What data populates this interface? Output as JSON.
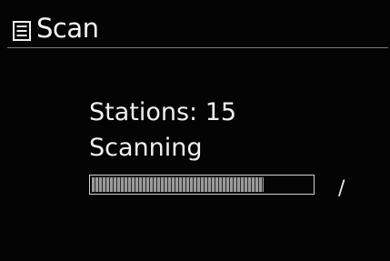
{
  "header": {
    "icon": "list-menu-icon",
    "title": "Scan"
  },
  "scan": {
    "stations_text": "Stations: 15",
    "status_text": "Scanning",
    "progress_fraction": 0.78,
    "spinner_glyph": "/"
  },
  "colors": {
    "background": "#040404",
    "text": "#f0f0f0",
    "progress_fill": "#9a9a9a",
    "progress_border": "#d0d0d0"
  }
}
